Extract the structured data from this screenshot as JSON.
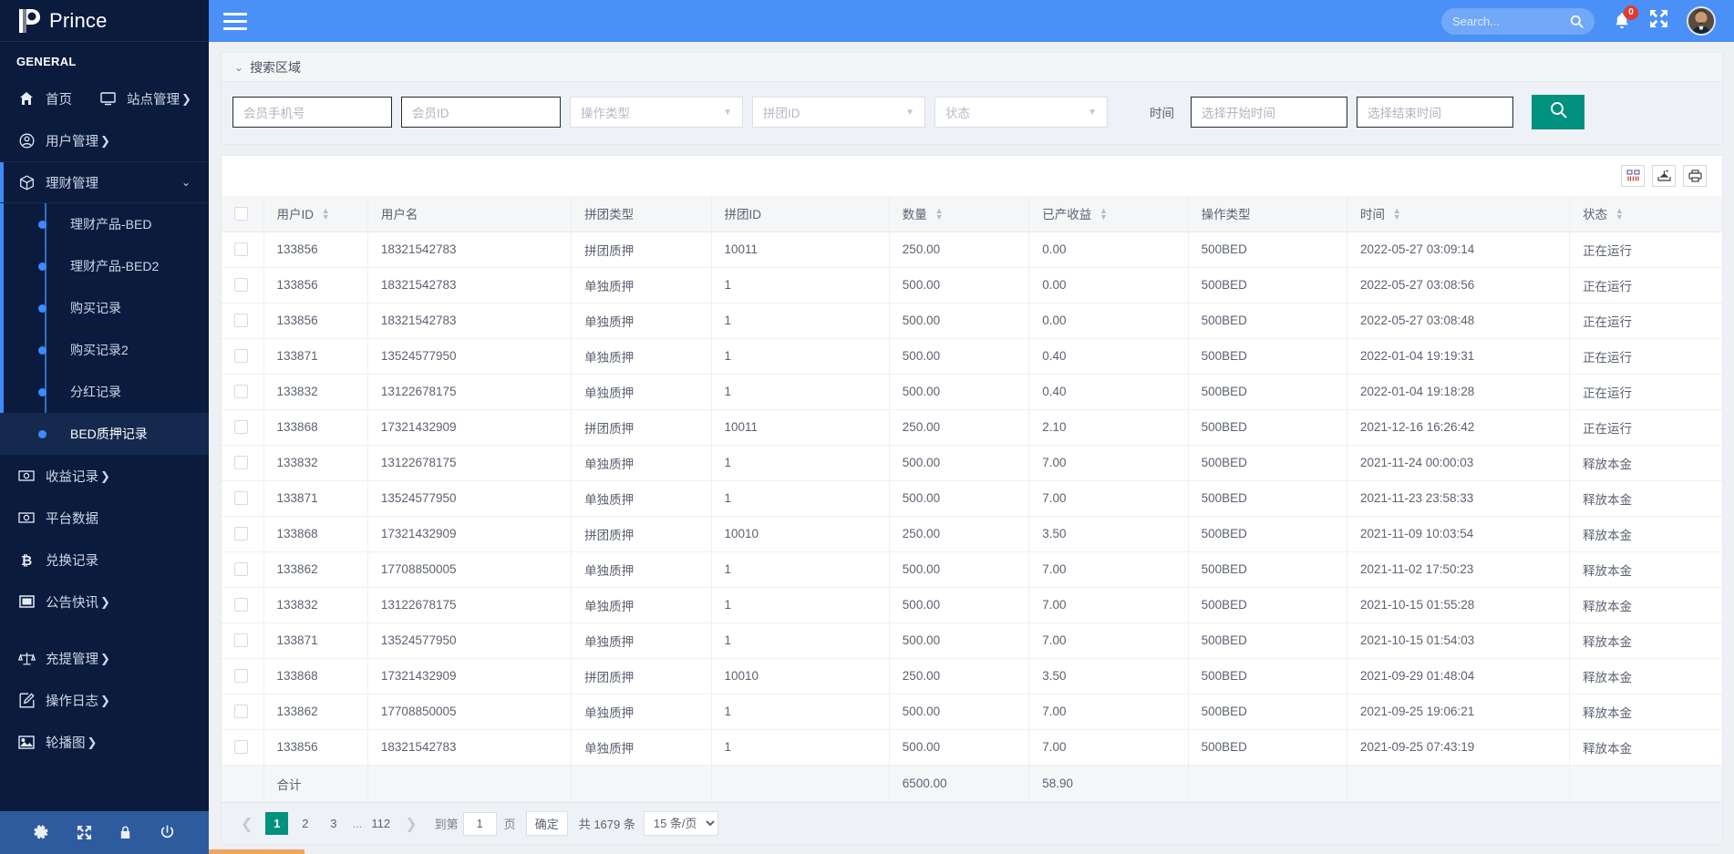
{
  "brand": {
    "name": "Prince",
    "logo_icon": "p-logo-icon"
  },
  "sidebar": {
    "section_label": "GENERAL",
    "items": [
      {
        "label": "首页",
        "icon": "home-icon",
        "caret": ""
      },
      {
        "label": "站点管理",
        "icon": "monitor-icon",
        "caret": "❯"
      },
      {
        "label": "用户管理",
        "icon": "user-circle-icon",
        "caret": "❯"
      },
      {
        "label": "理财管理",
        "icon": "box-icon",
        "caret": "⌄"
      },
      {
        "label": "收益记录",
        "icon": "money-icon",
        "caret": "❯"
      },
      {
        "label": "平台数据",
        "icon": "money-icon",
        "caret": ""
      },
      {
        "label": "兑换记录",
        "icon": "bitcoin-icon",
        "caret": ""
      },
      {
        "label": "公告快讯",
        "icon": "window-icon",
        "caret": "❯"
      },
      {
        "label": "充提管理",
        "icon": "scales-icon",
        "caret": "❯"
      },
      {
        "label": "操作日志",
        "icon": "edit-icon",
        "caret": "❯"
      },
      {
        "label": "轮播图",
        "icon": "image-icon",
        "caret": "❯"
      }
    ],
    "submenu": [
      {
        "label": "理财产品-BED",
        "active": false
      },
      {
        "label": "理财产品-BED2",
        "active": false
      },
      {
        "label": "购买记录",
        "active": false
      },
      {
        "label": "购买记录2",
        "active": false
      },
      {
        "label": "分红记录",
        "active": false
      },
      {
        "label": "BED质押记录",
        "active": true
      }
    ],
    "footer_icons": [
      "gear-icon",
      "fullscreen-icon",
      "lock-icon",
      "power-icon"
    ]
  },
  "topbar": {
    "menu_icon": "hamburger-icon",
    "search_placeholder": "Search...",
    "search_value": "",
    "search_icon": "magnifier-icon",
    "notification_icon": "bell-icon",
    "notification_count": "0",
    "fullscreen_icon": "expand-icon",
    "avatar": "user-avatar"
  },
  "search_panel": {
    "title": "搜索区域",
    "chevron": "⌄",
    "fields": {
      "phone_placeholder": "会员手机号",
      "phone_value": "",
      "memberid_placeholder": "会员ID",
      "memberid_value": "",
      "optype_placeholder": "操作类型",
      "groupid_placeholder": "拼团ID",
      "status_placeholder": "状态",
      "time_label": "时间",
      "start_placeholder": "选择开始时间",
      "end_placeholder": "选择结束时间"
    },
    "search_button_icon": "magnifier-icon"
  },
  "table_toolbar": [
    {
      "icon": "columns-icon"
    },
    {
      "icon": "export-icon"
    },
    {
      "icon": "print-icon"
    }
  ],
  "table": {
    "columns": [
      {
        "label": "",
        "key": "checkbox",
        "sortable": false
      },
      {
        "label": "用户ID",
        "key": "uid",
        "sortable": true
      },
      {
        "label": "用户名",
        "key": "username",
        "sortable": false
      },
      {
        "label": "拼团类型",
        "key": "ptype",
        "sortable": false
      },
      {
        "label": "拼团ID",
        "key": "pid",
        "sortable": false
      },
      {
        "label": "数量",
        "key": "qty",
        "sortable": true
      },
      {
        "label": "已产收益",
        "key": "yield",
        "sortable": true
      },
      {
        "label": "操作类型",
        "key": "optype",
        "sortable": false
      },
      {
        "label": "时间",
        "key": "time",
        "sortable": true
      },
      {
        "label": "状态",
        "key": "state",
        "sortable": true
      }
    ],
    "rows": [
      {
        "uid": "133856",
        "username": "18321542783",
        "ptype": "拼团质押",
        "pid": "10011",
        "qty": "250.00",
        "yield": "0.00",
        "optype": "500BED",
        "time": "2022-05-27 03:09:14",
        "state": "正在运行"
      },
      {
        "uid": "133856",
        "username": "18321542783",
        "ptype": "单独质押",
        "pid": "1",
        "qty": "500.00",
        "yield": "0.00",
        "optype": "500BED",
        "time": "2022-05-27 03:08:56",
        "state": "正在运行"
      },
      {
        "uid": "133856",
        "username": "18321542783",
        "ptype": "单独质押",
        "pid": "1",
        "qty": "500.00",
        "yield": "0.00",
        "optype": "500BED",
        "time": "2022-05-27 03:08:48",
        "state": "正在运行"
      },
      {
        "uid": "133871",
        "username": "13524577950",
        "ptype": "单独质押",
        "pid": "1",
        "qty": "500.00",
        "yield": "0.40",
        "optype": "500BED",
        "time": "2022-01-04 19:19:31",
        "state": "正在运行"
      },
      {
        "uid": "133832",
        "username": "13122678175",
        "ptype": "单独质押",
        "pid": "1",
        "qty": "500.00",
        "yield": "0.40",
        "optype": "500BED",
        "time": "2022-01-04 19:18:28",
        "state": "正在运行"
      },
      {
        "uid": "133868",
        "username": "17321432909",
        "ptype": "拼团质押",
        "pid": "10011",
        "qty": "250.00",
        "yield": "2.10",
        "optype": "500BED",
        "time": "2021-12-16 16:26:42",
        "state": "正在运行"
      },
      {
        "uid": "133832",
        "username": "13122678175",
        "ptype": "单独质押",
        "pid": "1",
        "qty": "500.00",
        "yield": "7.00",
        "optype": "500BED",
        "time": "2021-11-24 00:00:03",
        "state": "释放本金"
      },
      {
        "uid": "133871",
        "username": "13524577950",
        "ptype": "单独质押",
        "pid": "1",
        "qty": "500.00",
        "yield": "7.00",
        "optype": "500BED",
        "time": "2021-11-23 23:58:33",
        "state": "释放本金"
      },
      {
        "uid": "133868",
        "username": "17321432909",
        "ptype": "拼团质押",
        "pid": "10010",
        "qty": "250.00",
        "yield": "3.50",
        "optype": "500BED",
        "time": "2021-11-09 10:03:54",
        "state": "释放本金"
      },
      {
        "uid": "133862",
        "username": "17708850005",
        "ptype": "单独质押",
        "pid": "1",
        "qty": "500.00",
        "yield": "7.00",
        "optype": "500BED",
        "time": "2021-11-02 17:50:23",
        "state": "释放本金"
      },
      {
        "uid": "133832",
        "username": "13122678175",
        "ptype": "单独质押",
        "pid": "1",
        "qty": "500.00",
        "yield": "7.00",
        "optype": "500BED",
        "time": "2021-10-15 01:55:28",
        "state": "释放本金"
      },
      {
        "uid": "133871",
        "username": "13524577950",
        "ptype": "单独质押",
        "pid": "1",
        "qty": "500.00",
        "yield": "7.00",
        "optype": "500BED",
        "time": "2021-10-15 01:54:03",
        "state": "释放本金"
      },
      {
        "uid": "133868",
        "username": "17321432909",
        "ptype": "拼团质押",
        "pid": "10010",
        "qty": "250.00",
        "yield": "3.50",
        "optype": "500BED",
        "time": "2021-09-29 01:48:04",
        "state": "释放本金"
      },
      {
        "uid": "133862",
        "username": "17708850005",
        "ptype": "单独质押",
        "pid": "1",
        "qty": "500.00",
        "yield": "7.00",
        "optype": "500BED",
        "time": "2021-09-25 19:06:21",
        "state": "释放本金"
      },
      {
        "uid": "133856",
        "username": "18321542783",
        "ptype": "单独质押",
        "pid": "1",
        "qty": "500.00",
        "yield": "7.00",
        "optype": "500BED",
        "time": "2021-09-25 07:43:19",
        "state": "释放本金"
      }
    ],
    "footer": {
      "label": "合计",
      "qty_total": "6500.00",
      "yield_total": "58.90"
    }
  },
  "pagination": {
    "prev": "❮",
    "next": "❯",
    "pages": [
      "1",
      "2",
      "3"
    ],
    "ellipsis": "...",
    "last_page": "112",
    "goto_label": "到第",
    "goto_value": "1",
    "page_unit": "页",
    "confirm": "确定",
    "total_text": "共 1679 条",
    "page_size": "15 条/页"
  }
}
